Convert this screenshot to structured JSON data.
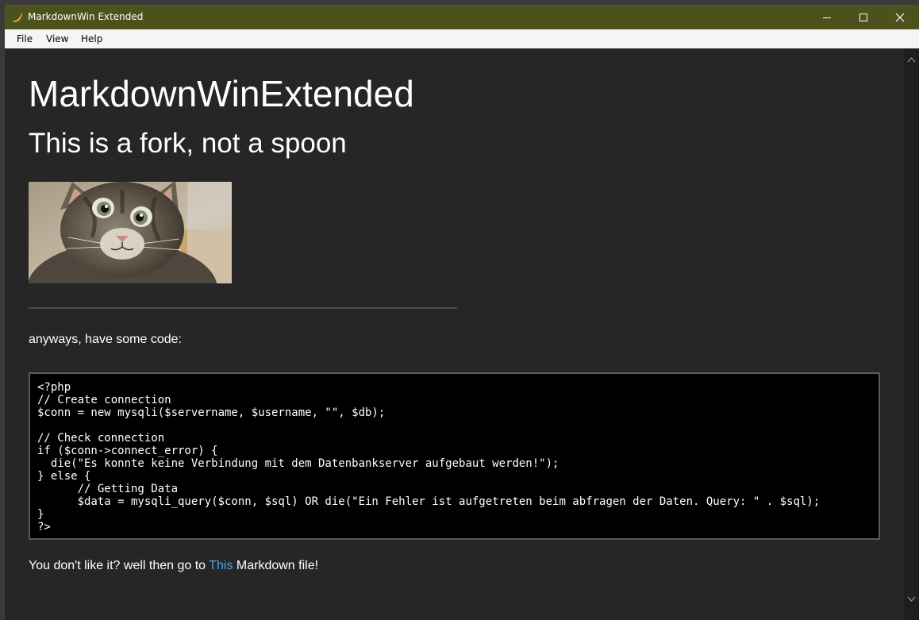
{
  "window": {
    "title": "MarkdownWin Extended",
    "icon": "banana-icon",
    "title_color": "#4d521d"
  },
  "menu": [
    {
      "label": "File"
    },
    {
      "label": "View"
    },
    {
      "label": "Help"
    }
  ],
  "document": {
    "h1": "MarkdownWinExtended",
    "h2": "This is a fork, not a spoon",
    "image_alt": "kitten photo",
    "intro": "anyways, have some code:",
    "code_lines": [
      "<?php",
      "// Create connection",
      "$conn = new mysqli($servername, $username, \"\", $db);",
      "",
      "// Check connection",
      "if ($conn->connect_error) {",
      "  die(\"Es konnte keine Verbindung mit dem Datenbankserver aufgebaut werden!\");",
      "} else {",
      "      // Getting Data",
      "      $data = mysqli_query($conn, $sql) OR die(\"Ein Fehler ist aufgetreten beim abfragen der Daten. Query: \" . $sql);",
      "}",
      "?>"
    ],
    "footer": {
      "before": "You don't like it? well then go to ",
      "link": "This",
      "after": " Markdown file!"
    },
    "link_color": "#4aa8ec"
  }
}
